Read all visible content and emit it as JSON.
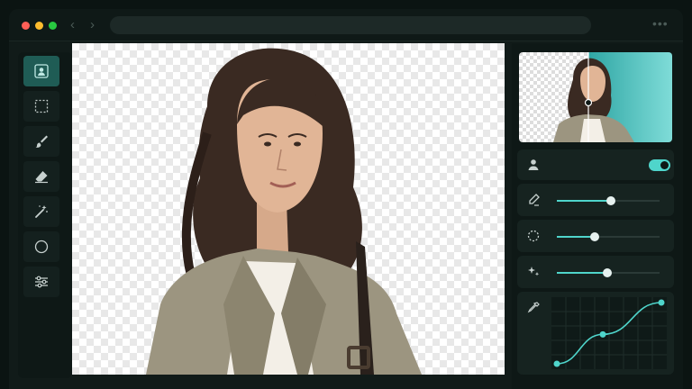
{
  "window": {
    "controls": [
      "close",
      "minimize",
      "maximize"
    ],
    "control_colors": [
      "#ff5f57",
      "#febc2e",
      "#28c840"
    ],
    "nav": {
      "back_glyph": "‹",
      "forward_glyph": "›"
    },
    "menu_glyph": "•••"
  },
  "accent": "#4fd5cb",
  "toolbar": {
    "tools": [
      {
        "icon": "person-select-icon",
        "active": true
      },
      {
        "icon": "marquee-select-icon",
        "active": false
      },
      {
        "icon": "brush-icon",
        "active": false
      },
      {
        "icon": "eraser-icon",
        "active": false
      },
      {
        "icon": "magic-wand-icon",
        "active": false
      },
      {
        "icon": "circle-select-icon",
        "active": false
      },
      {
        "icon": "sliders-icon",
        "active": false
      }
    ]
  },
  "canvas": {
    "background": "transparent-checkerboard",
    "subject": "woman-in-trench-coat-cutout"
  },
  "panel": {
    "preview": {
      "split_fraction": 0.45
    },
    "subject_toggle": {
      "icon": "person-icon",
      "on": true
    },
    "sliders": [
      {
        "icon": "edge-pen-icon",
        "value": 0.53
      },
      {
        "icon": "feather-circle-icon",
        "value": 0.37
      },
      {
        "icon": "sparkle-icon",
        "value": 0.49
      }
    ],
    "curve": {
      "icon": "eyedropper-icon",
      "points": [
        [
          0.0,
          0.0
        ],
        [
          0.44,
          0.48
        ],
        [
          1.0,
          1.0
        ]
      ]
    }
  }
}
